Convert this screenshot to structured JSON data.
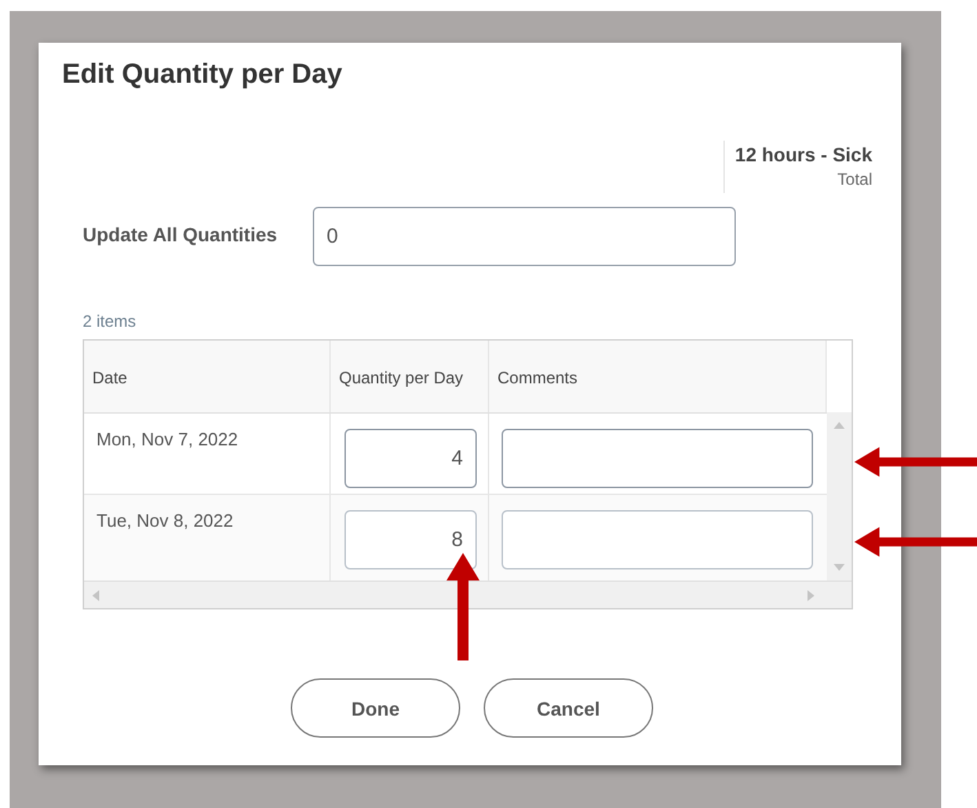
{
  "dialog": {
    "title": "Edit Quantity per Day"
  },
  "total": {
    "value": "12 hours - Sick",
    "label": "Total"
  },
  "update_all": {
    "label": "Update All Quantities",
    "value": "0"
  },
  "item_count": "2 items",
  "table": {
    "columns": [
      "Date",
      "Quantity per Day",
      "Comments"
    ],
    "rows": [
      {
        "date": "Mon, Nov 7, 2022",
        "quantity": "4",
        "comments": ""
      },
      {
        "date": "Tue, Nov 8, 2022",
        "quantity": "8",
        "comments": ""
      }
    ]
  },
  "buttons": [
    "Done",
    "Cancel"
  ]
}
